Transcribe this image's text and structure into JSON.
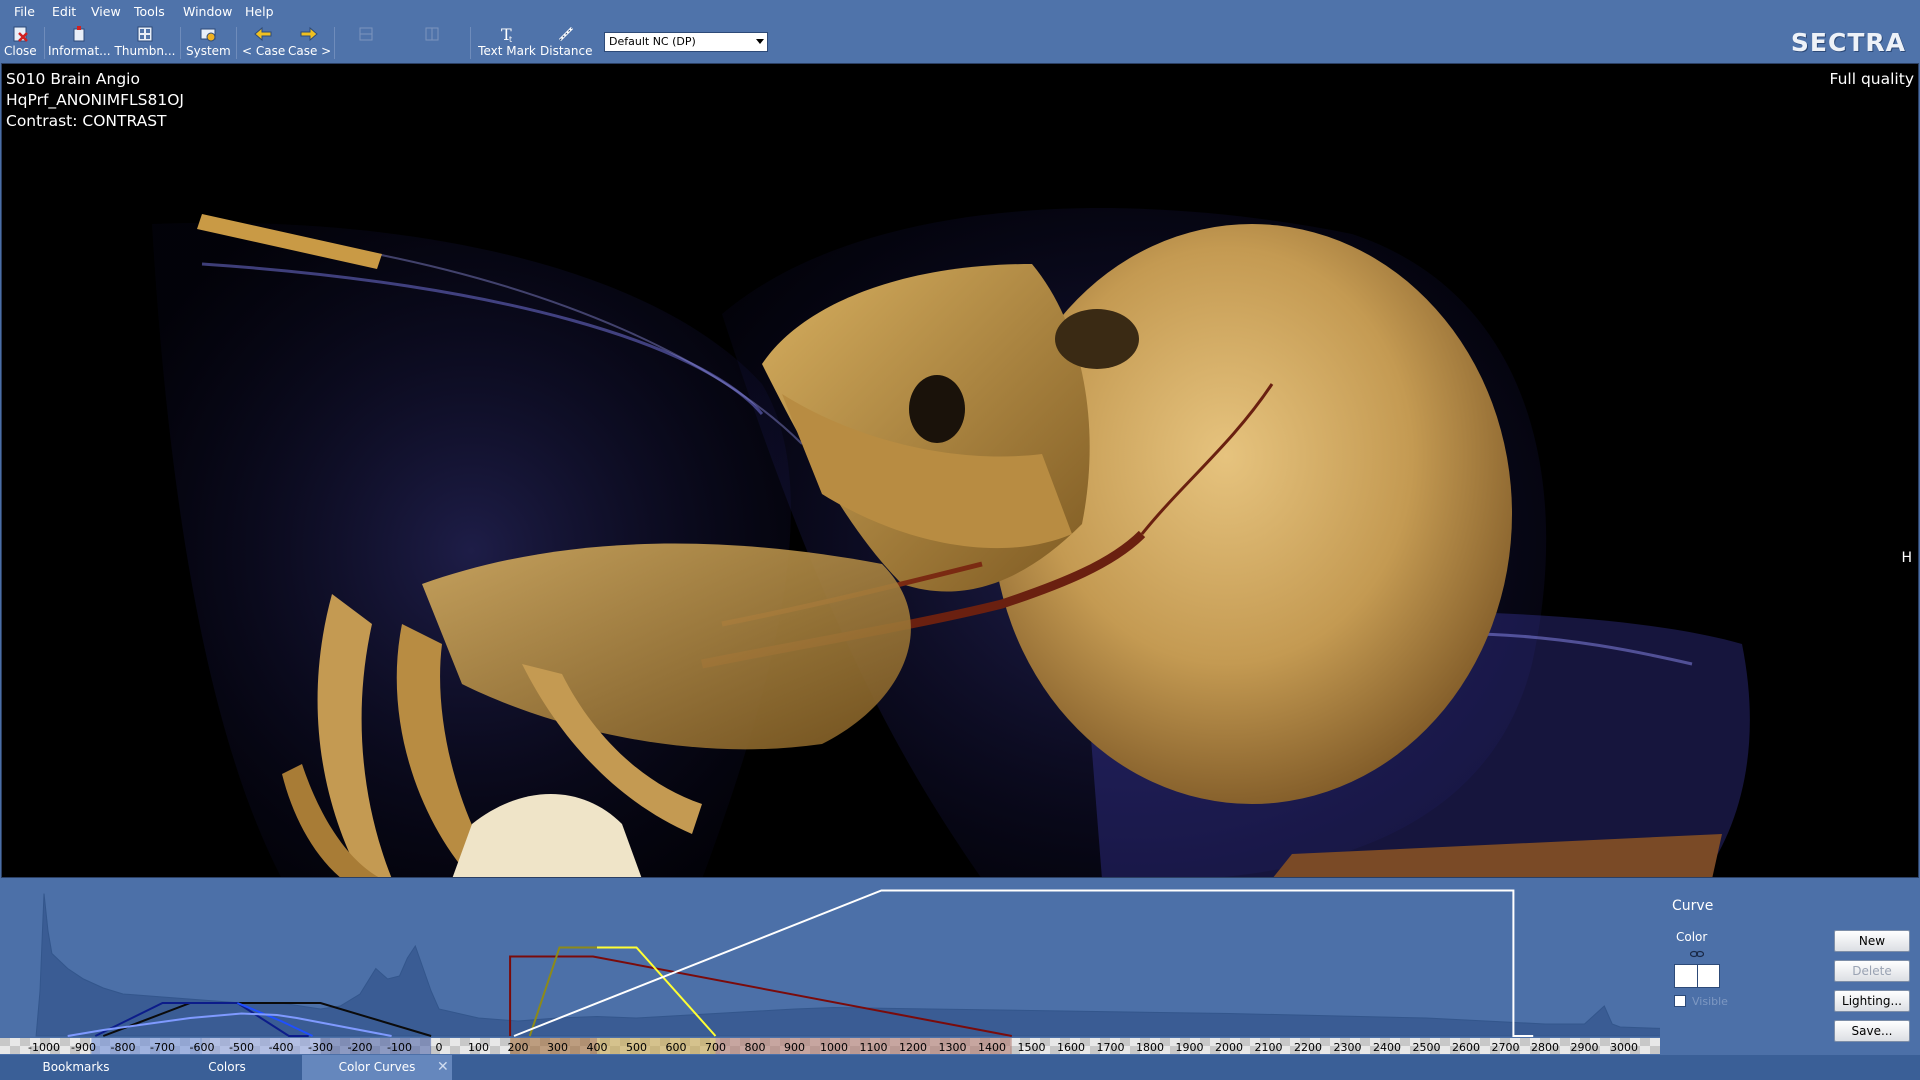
{
  "menu": [
    "File",
    "Edit",
    "View",
    "Tools",
    "Window",
    "Help"
  ],
  "toolbar": {
    "close": "Close",
    "information": "Informat...",
    "thumbnails": "Thumbn...",
    "system": "System",
    "prev_case": "< Case",
    "next_case": "Case >",
    "text_mark": "Text Mark",
    "distance": "Distance",
    "preset": "Default NC (DP)"
  },
  "brand": "SECTRA",
  "overlay": {
    "line1": "S010 Brain Angio",
    "line2": "HqPrf_ANONIMFLS81OJ",
    "line3": "Contrast: CONTRAST",
    "quality": "Full quality",
    "orientation": "H"
  },
  "editor": {
    "curve_label": "Curve",
    "color_label": "Color",
    "visible_label": "Visible",
    "buttons": {
      "new": "New",
      "delete": "Delete",
      "lighting": "Lighting...",
      "save": "Save..."
    }
  },
  "tabs": {
    "bookmarks": "Bookmarks",
    "colors": "Colors",
    "color_curves": "Color Curves"
  },
  "colors": {
    "black_curve": "#0b0b0b",
    "navy_curve": "#0c1c8a",
    "blue_curve": "#1f4fff",
    "light_blue_curve": "#7f9aff",
    "dark_red_curve": "#7a0b0b",
    "olive_curve": "#8c8a1a",
    "yellow_curve": "#ffff33",
    "white_curve": "#ffffff"
  },
  "chart_data": {
    "type": "line",
    "x_ticks": [
      -1000,
      -900,
      -800,
      -700,
      -600,
      -500,
      -400,
      -300,
      -200,
      -100,
      0,
      100,
      200,
      300,
      400,
      500,
      600,
      700,
      800,
      900,
      1000,
      1100,
      1200,
      1300,
      1400,
      1500,
      1600,
      1700,
      1800,
      1900,
      2000,
      2100,
      2200,
      2300,
      2400,
      2500,
      2600,
      2700,
      2800,
      2900,
      3000
    ],
    "xlim": [
      -1020,
      3270
    ],
    "ylim": [
      0,
      1
    ],
    "histogram": {
      "x": [
        -1020,
        -1010,
        -1000,
        -990,
        -980,
        -960,
        -940,
        -900,
        -850,
        -800,
        -700,
        -600,
        -500,
        -400,
        -300,
        -250,
        -200,
        -160,
        -130,
        -100,
        -80,
        -60,
        -40,
        -20,
        0,
        100,
        200,
        300,
        400,
        500,
        700,
        900,
        1000,
        1500,
        2000,
        2500,
        2800,
        2900,
        2950,
        2970,
        2990,
        3100,
        3200,
        3270
      ],
      "y": [
        0.0,
        0.3,
        0.95,
        0.7,
        0.55,
        0.5,
        0.45,
        0.38,
        0.32,
        0.28,
        0.26,
        0.24,
        0.22,
        0.22,
        0.18,
        0.2,
        0.28,
        0.45,
        0.38,
        0.4,
        0.52,
        0.6,
        0.45,
        0.3,
        0.18,
        0.12,
        0.1,
        0.12,
        0.13,
        0.12,
        0.15,
        0.18,
        0.19,
        0.17,
        0.15,
        0.12,
        0.08,
        0.08,
        0.2,
        0.08,
        0.06,
        0.05,
        0.04,
        0.0
      ]
    },
    "curves": [
      {
        "color": "#0b0b0b",
        "x": [
          -850,
          -630,
          -400,
          -300,
          -20
        ],
        "y": [
          0.0,
          0.22,
          0.22,
          0.22,
          0.0
        ]
      },
      {
        "color": "#0c1c8a",
        "x": [
          -870,
          -700,
          -510,
          -380,
          -330
        ],
        "y": [
          0.0,
          0.22,
          0.22,
          0.0,
          0.0
        ]
      },
      {
        "color": "#1f4fff",
        "x": [
          -510,
          -400,
          -320
        ],
        "y": [
          0.22,
          0.1,
          0.0
        ]
      },
      {
        "color": "#7f9aff",
        "x": [
          -940,
          -850,
          -630,
          -500,
          -410,
          -360,
          -280,
          -120
        ],
        "y": [
          0.0,
          0.04,
          0.12,
          0.15,
          0.14,
          0.12,
          0.08,
          0.0
        ]
      },
      {
        "color": "#7a0b0b",
        "x": [
          180,
          180,
          390,
          1450
        ],
        "y": [
          0.0,
          0.53,
          0.53,
          0.0
        ]
      },
      {
        "color": "#8c8a1a",
        "x": [
          230,
          305,
          400
        ],
        "y": [
          0.0,
          0.59,
          0.59
        ]
      },
      {
        "color": "#ffff33",
        "x": [
          400,
          500,
          700
        ],
        "y": [
          0.59,
          0.59,
          0.0
        ]
      },
      {
        "color": "#ffffff",
        "x": [
          190,
          1120,
          2720,
          2720,
          2770
        ],
        "y": [
          0.0,
          0.97,
          0.97,
          0.0,
          0.0
        ]
      }
    ]
  }
}
